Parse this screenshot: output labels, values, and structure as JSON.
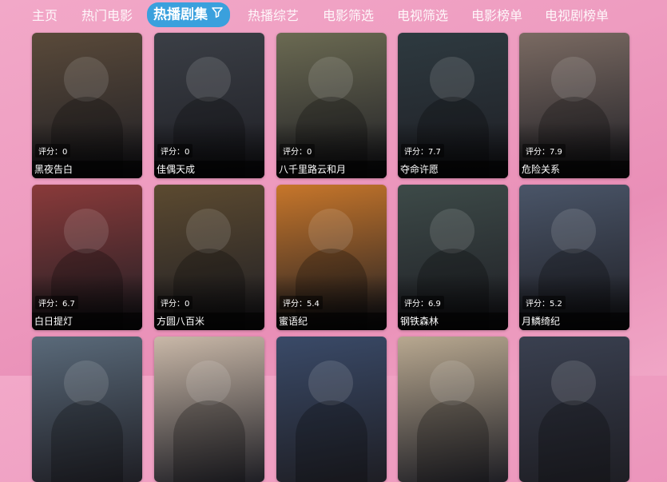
{
  "nav": {
    "items": [
      {
        "label": "主页"
      },
      {
        "label": "热门电影"
      },
      {
        "label": "热播剧集"
      },
      {
        "label": "热播综艺"
      },
      {
        "label": "电影筛选"
      },
      {
        "label": "电视筛选"
      },
      {
        "label": "电影榜单"
      },
      {
        "label": "电视剧榜单"
      }
    ],
    "active_index": 2,
    "filter_icon": "filter-icon"
  },
  "score_prefix": "评分：",
  "shows": [
    {
      "title": "黑夜告白",
      "score": "0",
      "color": "#5a4a3a"
    },
    {
      "title": "佳偶天成",
      "score": "0",
      "color": "#3b3f46"
    },
    {
      "title": "八千里路云和月",
      "score": "0",
      "color": "#6b6a52"
    },
    {
      "title": "夺命许愿",
      "score": "7.7",
      "color": "#2e3a40"
    },
    {
      "title": "危险关系",
      "score": "7.9",
      "color": "#7a6a62"
    },
    {
      "title": "白日提灯",
      "score": "6.7",
      "color": "#8a3a3a"
    },
    {
      "title": "方圆八百米",
      "score": "0",
      "color": "#5c4a30"
    },
    {
      "title": "蜜语纪",
      "score": "5.4",
      "color": "#c7762a"
    },
    {
      "title": "钢铁森林",
      "score": "6.9",
      "color": "#3d4a48"
    },
    {
      "title": "月鳞绮纪",
      "score": "5.2",
      "color": "#4a5568"
    },
    {
      "title": "",
      "score": "",
      "color": "#5a6a7a"
    },
    {
      "title": "",
      "score": "",
      "color": "#c9b8a8"
    },
    {
      "title": "",
      "score": "",
      "color": "#3a4a68"
    },
    {
      "title": "",
      "score": "",
      "color": "#b8a890"
    },
    {
      "title": "",
      "score": "",
      "color": "#3a4050"
    }
  ]
}
